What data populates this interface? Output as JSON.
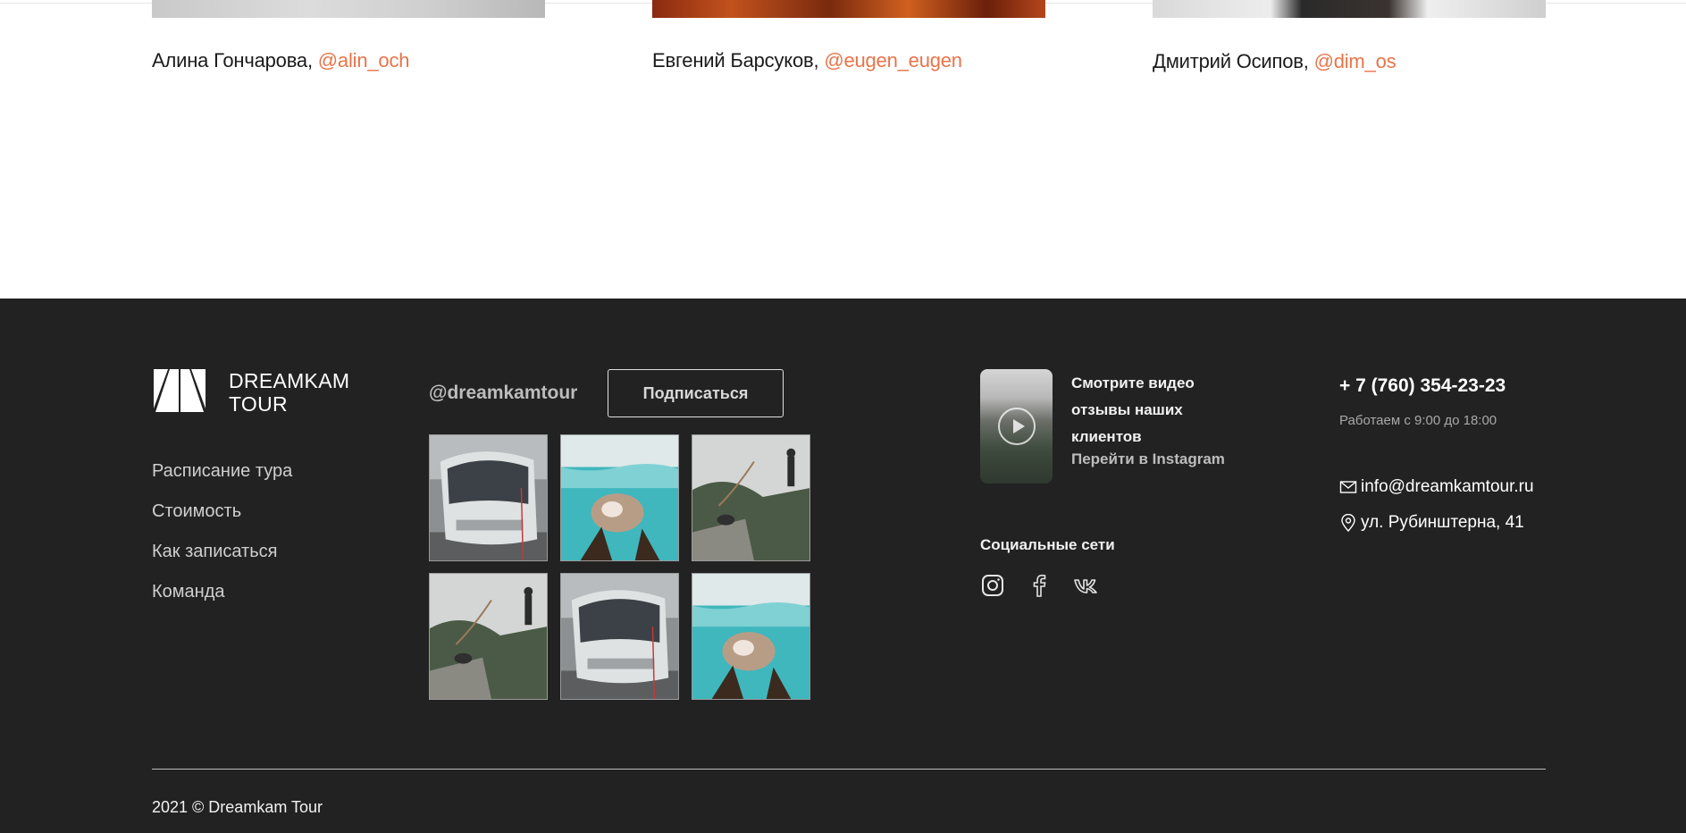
{
  "team": {
    "members": [
      {
        "name": "Алина Гончарова, ",
        "handle": "@alin_och"
      },
      {
        "name": "Евгений Барсуков, ",
        "handle": "@eugen_eugen"
      },
      {
        "name": "Дмитрий Осипов, ",
        "handle": "@dim_os"
      }
    ]
  },
  "footer": {
    "logo": {
      "line1": "DREAMKAM",
      "line2": "TOUR"
    },
    "nav": [
      "Расписание тура",
      "Стоимость",
      "Как записаться",
      "Команда"
    ],
    "instagram": {
      "handle": "@dreamkamtour",
      "subscribe_label": "Подписаться",
      "photos": [
        "bus-photo",
        "underwater-photo",
        "bungee-photo",
        "bungee-photo",
        "bus-photo",
        "underwater-photo"
      ]
    },
    "video": {
      "text": "Смотрите видео отзывы наших клиентов",
      "link": "Перейти в Instagram"
    },
    "social": {
      "title": "Социальные сети",
      "icons": [
        "instagram-icon",
        "facebook-icon",
        "vk-icon"
      ]
    },
    "contacts": {
      "phone": "+ 7 (760) 354-23-23",
      "hours": "Работаем с 9:00 до 18:00",
      "email": "info@dreamkamtour.ru",
      "address": "ул. Рубинштерна, 41"
    },
    "copyright": "2021 © Dreamkam Tour"
  },
  "colors": {
    "accent": "#e8744a",
    "footer_bg": "#222222"
  }
}
